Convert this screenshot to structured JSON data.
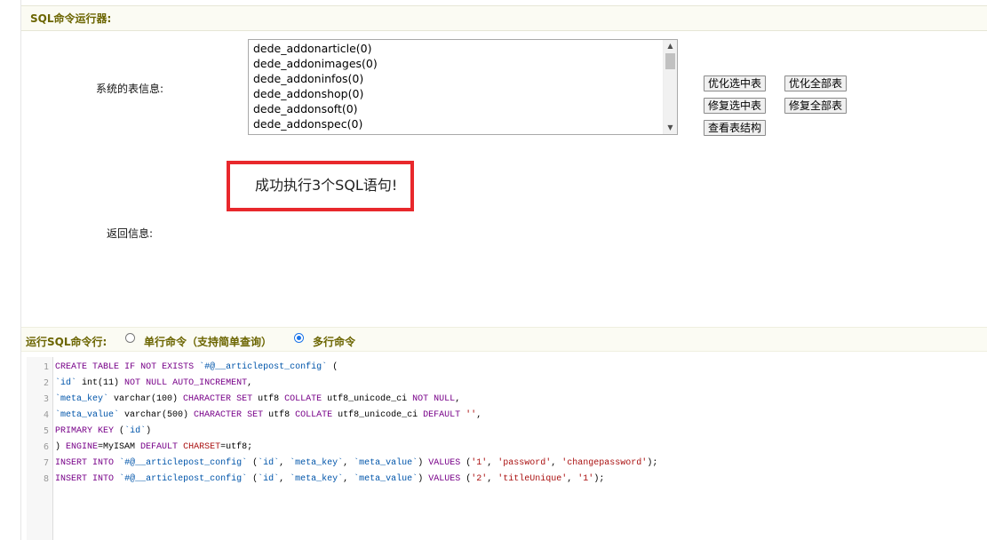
{
  "header": {
    "title": "SQL命令运行器:"
  },
  "table_info": {
    "label": "系统的表信息:",
    "tables": [
      "dede_addonarticle(0)",
      "dede_addonimages(0)",
      "dede_addoninfos(0)",
      "dede_addonshop(0)",
      "dede_addonsoft(0)",
      "dede_addonspec(0)"
    ]
  },
  "buttons": {
    "optimize_selected": "优化选中表",
    "optimize_all": "优化全部表",
    "repair_selected": "修复选中表",
    "repair_all": "修复全部表",
    "view_structure": "查看表结构"
  },
  "result": {
    "label": "返回信息:",
    "message": "成功执行3个SQL语句!"
  },
  "run": {
    "label": "运行SQL命令行:",
    "mode_single": "单行命令（支持简单查询）",
    "mode_multi": "多行命令",
    "selected": "多行命令"
  },
  "editor": {
    "line_numbers": [
      "1",
      "2",
      "3",
      "4",
      "5",
      "6",
      "7",
      "8"
    ],
    "lines": [
      "CREATE TABLE IF NOT EXISTS `#@__articlepost_config` (",
      "`id` int(11) NOT NULL AUTO_INCREMENT,",
      "`meta_key` varchar(100) CHARACTER SET utf8 COLLATE utf8_unicode_ci NOT NULL,",
      "`meta_value` varchar(500) CHARACTER SET utf8 COLLATE utf8_unicode_ci DEFAULT '',",
      "PRIMARY KEY (`id`)",
      ") ENGINE=MyISAM DEFAULT CHARSET=utf8;",
      "INSERT INTO `#@__articlepost_config` (`id`, `meta_key`, `meta_value`) VALUES ('1', 'password', 'changepassword');",
      "INSERT INTO `#@__articlepost_config` (`id`, `meta_key`, `meta_value`) VALUES ('2', 'titleUnique', '1');"
    ]
  }
}
